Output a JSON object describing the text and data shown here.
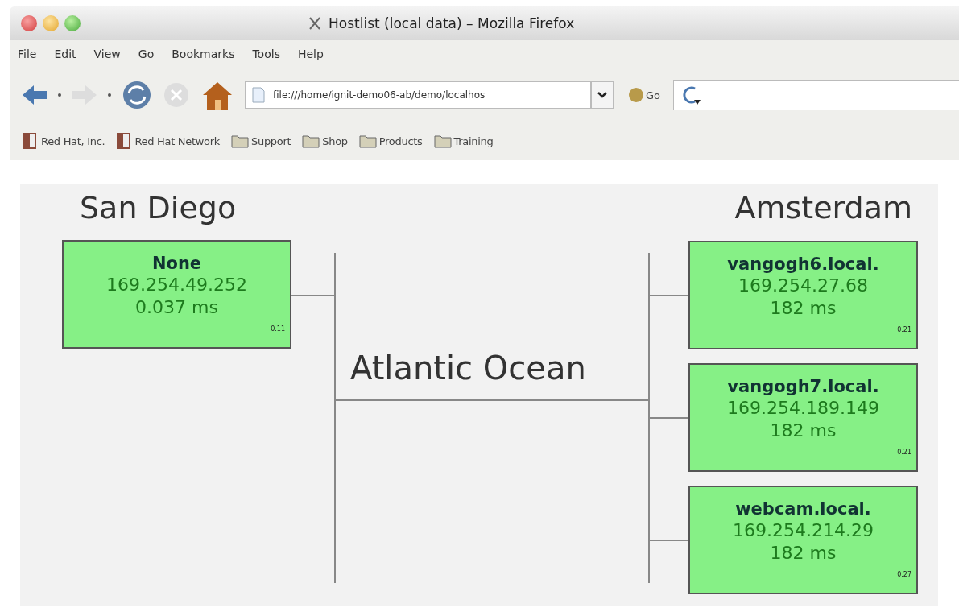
{
  "window": {
    "title": "Hostlist (local data) – Mozilla Firefox"
  },
  "menu": [
    "File",
    "Edit",
    "View",
    "Go",
    "Bookmarks",
    "Tools",
    "Help"
  ],
  "toolbar": {
    "address": "file:///home/ignit-demo06-ab/demo/localhos",
    "go_label": "Go",
    "back_enabled": true,
    "forward_enabled": false,
    "stop_enabled": false
  },
  "bookmarks": [
    {
      "kind": "page",
      "label": "Red Hat, Inc."
    },
    {
      "kind": "page",
      "label": "Red Hat Network"
    },
    {
      "kind": "folder",
      "label": "Support"
    },
    {
      "kind": "folder",
      "label": "Shop"
    },
    {
      "kind": "folder",
      "label": "Products"
    },
    {
      "kind": "folder",
      "label": "Training"
    }
  ],
  "diagram": {
    "left_site": "San Diego",
    "middle_label": "Atlantic Ocean",
    "right_site": "Amsterdam",
    "left_hosts": [
      {
        "name": "None",
        "ip": "169.254.49.252",
        "latency": "0.037 ms",
        "version": "0.11"
      }
    ],
    "right_hosts": [
      {
        "name": "vangogh6.local.",
        "ip": "169.254.27.68",
        "latency": "182 ms",
        "version": "0.21"
      },
      {
        "name": "vangogh7.local.",
        "ip": "169.254.189.149",
        "latency": "182 ms",
        "version": "0.21"
      },
      {
        "name": "webcam.local.",
        "ip": "169.254.214.29",
        "latency": "182 ms",
        "version": "0.27"
      }
    ]
  }
}
